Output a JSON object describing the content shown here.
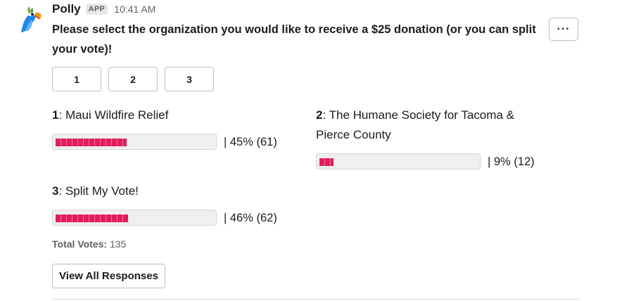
{
  "app": {
    "name": "Polly",
    "badge": "APP",
    "timestamp": "10:41 AM",
    "icon": "polly-parrot-logo"
  },
  "message": {
    "text": "Please select the organization you would like to receive a $25 donation (or you can split your vote)!"
  },
  "more_button": {
    "icon": "more-horizontal-icon",
    "label": "···"
  },
  "vote_buttons": [
    {
      "label": "1"
    },
    {
      "label": "2"
    },
    {
      "label": "3"
    }
  ],
  "options": [
    {
      "number": "1",
      "separator": ":",
      "name": "Maui Wildfire Relief",
      "stat": "| 45% (61)",
      "percent": 45,
      "votes": 61
    },
    {
      "number": "2",
      "separator": ":",
      "name": "The Humane Society for Tacoma & Pierce County",
      "stat": "| 9% (12)",
      "percent": 9,
      "votes": 12
    },
    {
      "number": "3",
      "separator": ":",
      "name": "Split My Vote!",
      "stat": "| 46% (62)",
      "percent": 46,
      "votes": 62
    }
  ],
  "total": {
    "label": "Total Votes:",
    "value": "135"
  },
  "view_all_button": {
    "label": "View All Responses"
  },
  "colors": {
    "bar_fill": "#e01e5a",
    "bar_track": "#efefef",
    "text": "#1d1c1d",
    "muted": "#616061"
  }
}
